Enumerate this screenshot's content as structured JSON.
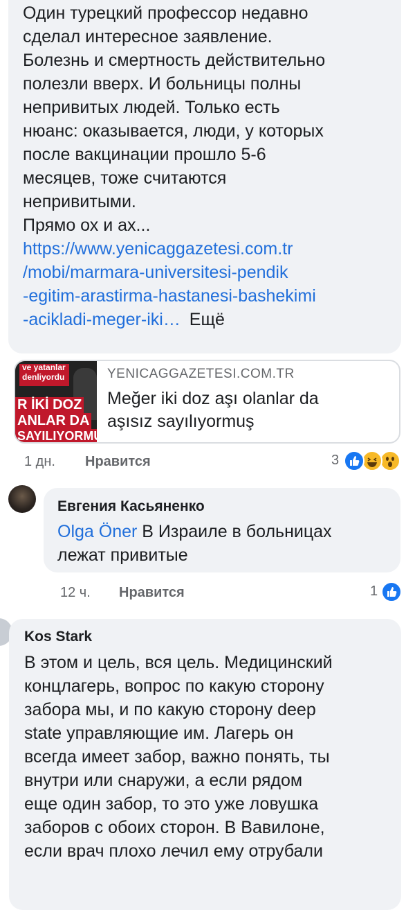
{
  "comment1": {
    "lines": [
      "Один турецкий профессор недавно",
      "сделал интересное заявление.",
      "Болезнь и смертность действительно",
      "полезли вверх. И больницы полны",
      "непривитых людей. Только есть",
      "нюанс: оказывается,  люди, у которых",
      "после вакцинации прошло 5-6",
      "месяцев, тоже считаются",
      "непривитыми.",
      "Прямо ох и ах..."
    ],
    "link_lines": [
      "https://www.yenicaggazetesi.com.tr",
      "/mobi/marmara-universitesi-pendik",
      "-egitim-arastirma-hastanesi-bashekimi",
      "-acikladi-meger-iki…"
    ],
    "more_label": "Ещё",
    "preview": {
      "domain": "YENICAGGAZETESI.COM.TR",
      "title_line1": "Meğer iki doz aşı olanlar da",
      "title_line2": "aşısız sayılıyormuş",
      "thumb_text1": "ve yatanlar",
      "thumb_text2": "denliyordu",
      "thumb_text3": "R İKİ DOZ",
      "thumb_text4": "ANLAR DA",
      "thumb_text5": "SAYILIYORMU"
    },
    "time": "1 дн.",
    "like_label": "Нравится",
    "reaction_count": "3"
  },
  "comment2": {
    "author": "Евгения Касьяненко",
    "mention": "Olga Öner",
    "text_line1": " В Израиле в больницах",
    "text_line2": "лежат привитые",
    "time": "12 ч.",
    "like_label": "Нравится",
    "reaction_count": "1"
  },
  "comment3": {
    "author": "Kos Stark",
    "lines": [
      "В этом и цель, вся цель. Медицинский",
      "концлагерь, вопрос по какую сторону",
      "забора мы, и по какую сторону deep",
      "state управляющие им. Лагерь он",
      "всегда имеет забор, важно понять, ты",
      "внутри или снаружи, а если рядом",
      "еще один забор, то это уже ловушка",
      "заборов с обоих сторон. В Вавилоне,",
      "если врач плохо лечил ему отрубали"
    ]
  },
  "colors": {
    "bubble": "#f0f2f5",
    "link": "#216fdb",
    "meta": "#65676b",
    "like_blue": "#1877f2",
    "haha_yellow": "#f7b928"
  },
  "icons": {
    "like": "like-reaction-icon",
    "haha": "haha-reaction-icon",
    "wow": "wow-reaction-icon"
  }
}
